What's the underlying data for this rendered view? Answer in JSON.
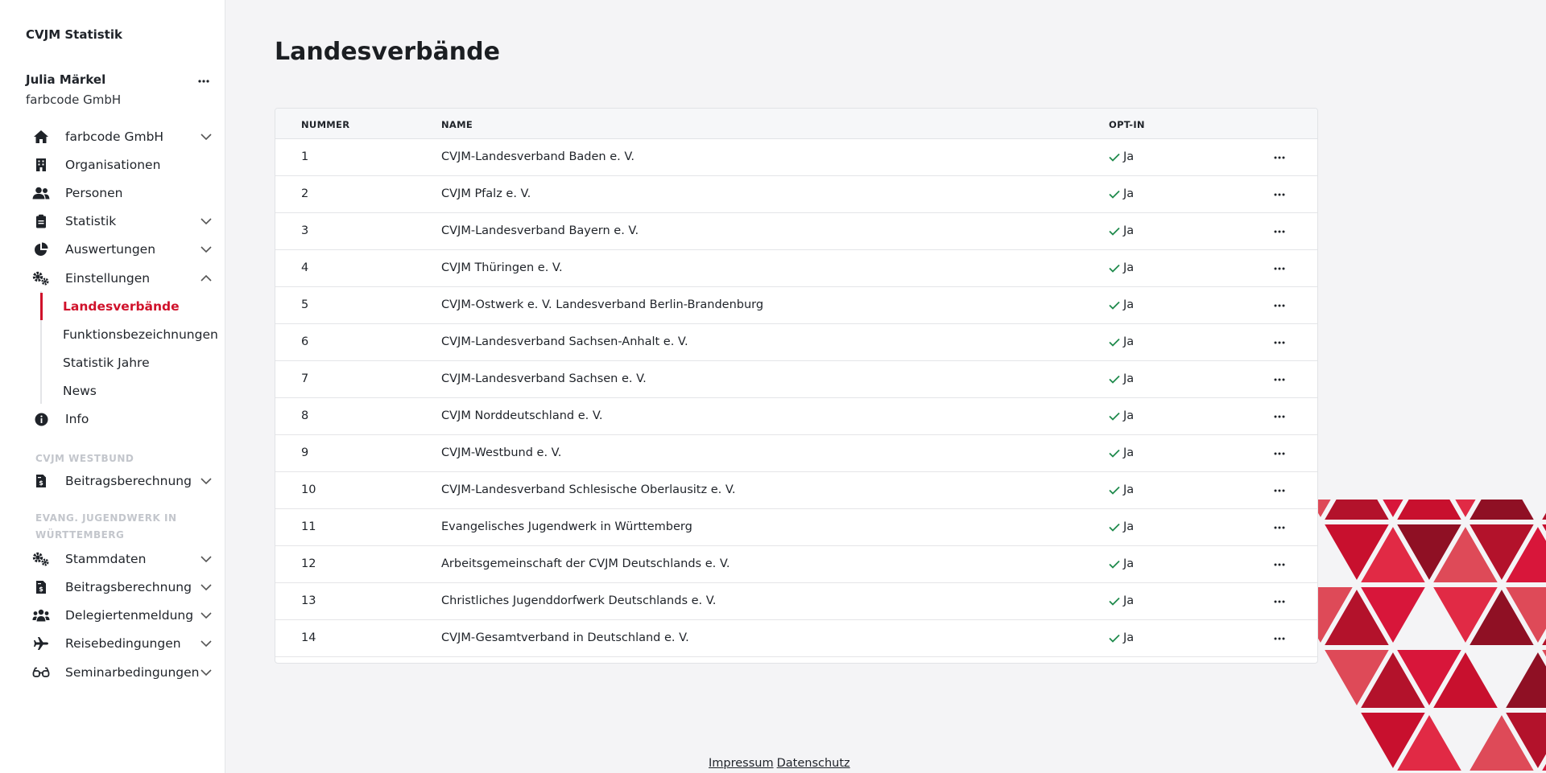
{
  "app": {
    "title": "CVJM Statistik"
  },
  "user": {
    "name": "Julia Märkel",
    "org": "farbcode GmbH",
    "menu_icon": "more-horizontal-icon"
  },
  "nav": {
    "items": [
      {
        "label": "farbcode GmbH",
        "icon": "home-icon",
        "chevron": "down"
      },
      {
        "label": "Organisationen",
        "icon": "building-icon"
      },
      {
        "label": "Personen",
        "icon": "users-icon"
      },
      {
        "label": "Statistik",
        "icon": "clipboard-icon",
        "chevron": "down"
      },
      {
        "label": "Auswertungen",
        "icon": "pie-chart-icon",
        "chevron": "down"
      },
      {
        "label": "Einstellungen",
        "icon": "cogs-icon",
        "chevron": "up"
      }
    ],
    "sub_items": [
      "Landesverbände",
      "Funktionsbezeichnungen",
      "Statistik Jahre",
      "News"
    ],
    "info": {
      "label": "Info",
      "icon": "info-icon"
    },
    "sections": [
      {
        "label": "CVJM WESTBUND",
        "items": [
          {
            "label": "Beitragsberechnung",
            "icon": "invoice-icon"
          }
        ]
      },
      {
        "label": "EVANG. JUGENDWERK IN WÜRTTEMBERG",
        "items": [
          {
            "label": "Stammdaten",
            "icon": "cogs-icon"
          },
          {
            "label": "Beitragsberechnung",
            "icon": "invoice-icon"
          },
          {
            "label": "Delegiertenmeldung",
            "icon": "group-icon"
          },
          {
            "label": "Reisebedingungen",
            "icon": "plane-icon"
          },
          {
            "label": "Seminarbedingungen",
            "icon": "glasses-icon"
          }
        ]
      }
    ]
  },
  "page": {
    "title": "Landesverbände"
  },
  "table": {
    "headers": {
      "number": "NUMMER",
      "name": "NAME",
      "optin": "OPT-IN"
    },
    "rows": [
      {
        "number": "1",
        "name": "CVJM-Landesverband Baden e. V.",
        "optin": "Ja"
      },
      {
        "number": "2",
        "name": "CVJM Pfalz e. V.",
        "optin": "Ja"
      },
      {
        "number": "3",
        "name": "CVJM-Landesverband Bayern e. V.",
        "optin": "Ja"
      },
      {
        "number": "4",
        "name": "CVJM Thüringen e. V.",
        "optin": "Ja"
      },
      {
        "number": "5",
        "name": "CVJM-Ostwerk e. V. Landesverband Berlin-Brandenburg",
        "optin": "Ja"
      },
      {
        "number": "6",
        "name": "CVJM-Landesverband Sachsen-Anhalt e. V.",
        "optin": "Ja"
      },
      {
        "number": "7",
        "name": "CVJM-Landesverband Sachsen e. V.",
        "optin": "Ja"
      },
      {
        "number": "8",
        "name": "CVJM Norddeutschland e. V.",
        "optin": "Ja"
      },
      {
        "number": "9",
        "name": "CVJM-Westbund e. V.",
        "optin": "Ja"
      },
      {
        "number": "10",
        "name": "CVJM-Landesverband Schlesische Oberlausitz e. V.",
        "optin": "Ja"
      },
      {
        "number": "11",
        "name": "Evangelisches Jugendwerk in Württemberg",
        "optin": "Ja"
      },
      {
        "number": "12",
        "name": "Arbeitsgemeinschaft der CVJM Deutschlands e. V.",
        "optin": "Ja"
      },
      {
        "number": "13",
        "name": "Christliches Jugenddorfwerk Deutschlands e. V.",
        "optin": "Ja"
      },
      {
        "number": "14",
        "name": "CVJM-Gesamtverband in Deutschland e. V.",
        "optin": "Ja"
      }
    ],
    "row_menu": "•••"
  },
  "footer": {
    "impressum": "Impressum",
    "datenschutz": "Datenschutz"
  },
  "colors": {
    "accent": "#d0122b",
    "check": "#1f8a4c"
  }
}
